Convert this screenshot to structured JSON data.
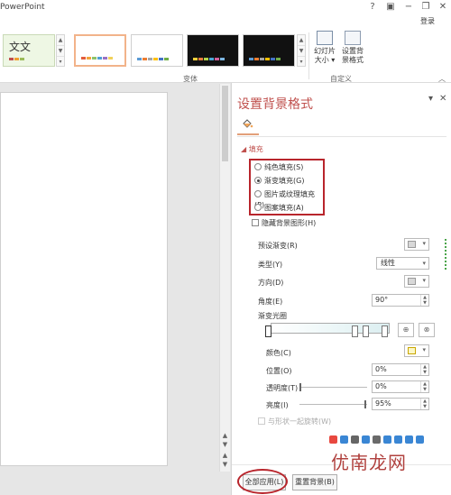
{
  "app": {
    "title": "PowerPoint",
    "help": "?",
    "ribbon_toggle": "▣",
    "minimize": "−",
    "restore": "❐",
    "close": "✕",
    "login": "登录"
  },
  "ribbon": {
    "style_sample_text": "文文",
    "scroll_up": "▲",
    "scroll_down": "▼",
    "scroll_more": "▾",
    "variants_label": "变体",
    "slide_size_label": "幻灯片大小",
    "slide_size_caret": "▾",
    "format_bg_label": "设置背景格式",
    "customize_label": "自定义",
    "collapse": "︿",
    "theme_colors": {
      "thumb_bars_1": [
        "#e35d3c",
        "#f4a43a",
        "#8dc36a",
        "#4f9fd6",
        "#9a72c4",
        "#f1d15b"
      ],
      "thumb_bars_2": [
        "#5b9bd5",
        "#ed7d31",
        "#a5a5a5",
        "#ffc000",
        "#4472c4",
        "#70ad47"
      ],
      "thumb_bars_3": [
        "#f7d13b",
        "#e97a3b",
        "#b1d34c",
        "#49a7d5",
        "#d1609a",
        "#7cb5e1"
      ]
    }
  },
  "panel": {
    "title": "设置背景格式",
    "dropdown_caret": "▾",
    "close": "✕",
    "fill_section": "◢ 填充",
    "fill_options": [
      {
        "label": "纯色填充(S)",
        "checked": false
      },
      {
        "label": "渐变填充(G)",
        "checked": true
      },
      {
        "label": "图片或纹理填充(P)",
        "checked": false
      },
      {
        "label": "图案填充(A)",
        "checked": false
      }
    ],
    "hide_bg_graphics": "隐藏背景图形(H)",
    "preset_gradient": "预设渐变(R)",
    "type_label": "类型(Y)",
    "type_value": "线性",
    "direction_label": "方向(D)",
    "angle_label": "角度(E)",
    "angle_value": "90°",
    "gradient_stops": "渐变光圈",
    "color_label": "颜色(C)",
    "position_label": "位置(O)",
    "position_value": "0%",
    "transparency_label": "透明度(T)",
    "transparency_value": "0%",
    "brightness_label": "亮度(I)",
    "brightness_value": "95%",
    "rotate_with_shape": "与形状一起旋转(W)",
    "apply_all": "全部应用(L)",
    "reset_bg": "重置背景(B)"
  },
  "watermark": {
    "text": "优南龙网",
    "icon_colors": [
      "#e8483f",
      "#3a86d4",
      "#666666",
      "#3a86d4",
      "#6a6a6a",
      "#3a86d4",
      "#3a86d4",
      "#3a86d4",
      "#3a86d4"
    ]
  }
}
